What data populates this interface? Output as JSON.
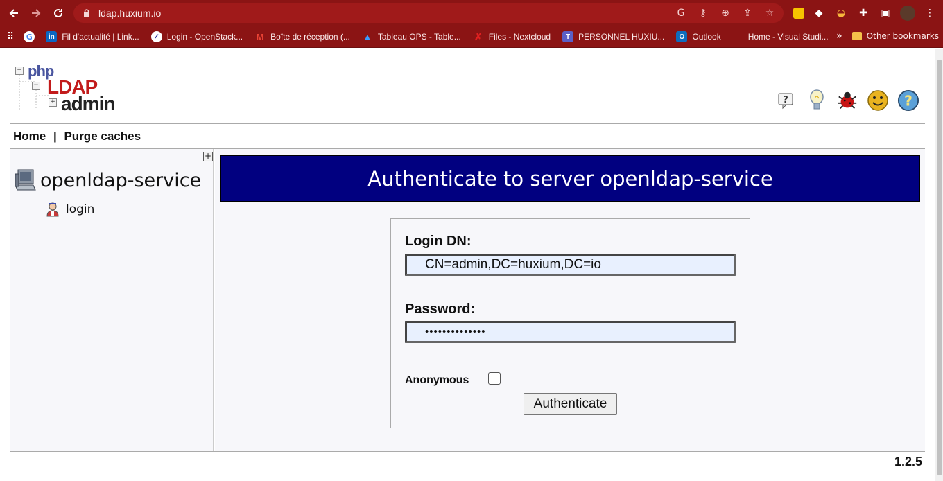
{
  "browser": {
    "url": "ldap.huxium.io",
    "bookmarks": [
      {
        "label": "Fil d'actualité | Link...",
        "icon": "linkedin-icon",
        "color": "#0a66c2"
      },
      {
        "label": "Login - OpenStack...",
        "icon": "openstack-icon",
        "color": "#2a2a9a"
      },
      {
        "label": "Boîte de réception (...",
        "icon": "gmail-icon",
        "color": "#c5221f"
      },
      {
        "label": "Tableau OPS - Table...",
        "icon": "azure-icon",
        "color": "#0078d4"
      },
      {
        "label": "Files - Nextcloud",
        "icon": "nextcloud-icon",
        "color": "#c81d1d"
      },
      {
        "label": "PERSONNEL HUXIU...",
        "icon": "teams-icon",
        "color": "#5b5fc7"
      },
      {
        "label": "Outlook",
        "icon": "outlook-icon",
        "color": "#0f6cbd"
      },
      {
        "label": "Home - Visual Studi...",
        "icon": "microsoft-icon",
        "color": "#f25022"
      }
    ],
    "other_bookmarks": "Other bookmarks",
    "overflow": "»"
  },
  "app": {
    "logo": {
      "php": "php",
      "ldap": "LDAP",
      "admin": "admin"
    },
    "menu": {
      "home": "Home",
      "separator": "|",
      "purge": "Purge caches"
    },
    "tree": {
      "server": "openldap-service",
      "login": "login",
      "expand": "+"
    },
    "title": "Authenticate to server openldap-service",
    "form": {
      "login_dn_label": "Login DN:",
      "login_dn_value": "CN=admin,DC=huxium,DC=io",
      "password_label": "Password:",
      "password_value": "••••••••••••••",
      "anonymous_label": "Anonymous",
      "anonymous_checked": false,
      "submit_label": "Authenticate"
    },
    "version": "1.2.5"
  }
}
